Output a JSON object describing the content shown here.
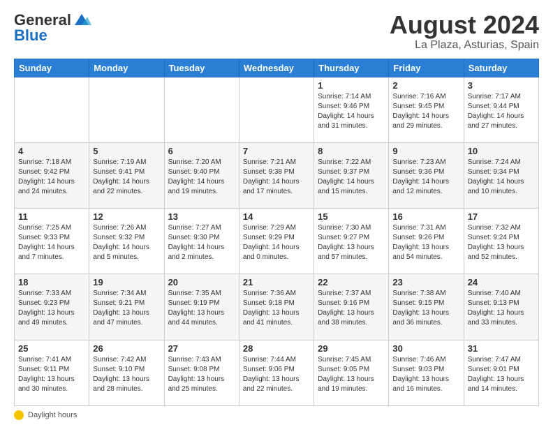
{
  "header": {
    "logo_line1": "General",
    "logo_line2": "Blue",
    "main_title": "August 2024",
    "subtitle": "La Plaza, Asturias, Spain"
  },
  "calendar": {
    "days_of_week": [
      "Sunday",
      "Monday",
      "Tuesday",
      "Wednesday",
      "Thursday",
      "Friday",
      "Saturday"
    ],
    "weeks": [
      [
        {
          "day": "",
          "info": ""
        },
        {
          "day": "",
          "info": ""
        },
        {
          "day": "",
          "info": ""
        },
        {
          "day": "",
          "info": ""
        },
        {
          "day": "1",
          "info": "Sunrise: 7:14 AM\nSunset: 9:46 PM\nDaylight: 14 hours\nand 31 minutes."
        },
        {
          "day": "2",
          "info": "Sunrise: 7:16 AM\nSunset: 9:45 PM\nDaylight: 14 hours\nand 29 minutes."
        },
        {
          "day": "3",
          "info": "Sunrise: 7:17 AM\nSunset: 9:44 PM\nDaylight: 14 hours\nand 27 minutes."
        }
      ],
      [
        {
          "day": "4",
          "info": "Sunrise: 7:18 AM\nSunset: 9:42 PM\nDaylight: 14 hours\nand 24 minutes."
        },
        {
          "day": "5",
          "info": "Sunrise: 7:19 AM\nSunset: 9:41 PM\nDaylight: 14 hours\nand 22 minutes."
        },
        {
          "day": "6",
          "info": "Sunrise: 7:20 AM\nSunset: 9:40 PM\nDaylight: 14 hours\nand 19 minutes."
        },
        {
          "day": "7",
          "info": "Sunrise: 7:21 AM\nSunset: 9:38 PM\nDaylight: 14 hours\nand 17 minutes."
        },
        {
          "day": "8",
          "info": "Sunrise: 7:22 AM\nSunset: 9:37 PM\nDaylight: 14 hours\nand 15 minutes."
        },
        {
          "day": "9",
          "info": "Sunrise: 7:23 AM\nSunset: 9:36 PM\nDaylight: 14 hours\nand 12 minutes."
        },
        {
          "day": "10",
          "info": "Sunrise: 7:24 AM\nSunset: 9:34 PM\nDaylight: 14 hours\nand 10 minutes."
        }
      ],
      [
        {
          "day": "11",
          "info": "Sunrise: 7:25 AM\nSunset: 9:33 PM\nDaylight: 14 hours\nand 7 minutes."
        },
        {
          "day": "12",
          "info": "Sunrise: 7:26 AM\nSunset: 9:32 PM\nDaylight: 14 hours\nand 5 minutes."
        },
        {
          "day": "13",
          "info": "Sunrise: 7:27 AM\nSunset: 9:30 PM\nDaylight: 14 hours\nand 2 minutes."
        },
        {
          "day": "14",
          "info": "Sunrise: 7:29 AM\nSunset: 9:29 PM\nDaylight: 14 hours\nand 0 minutes."
        },
        {
          "day": "15",
          "info": "Sunrise: 7:30 AM\nSunset: 9:27 PM\nDaylight: 13 hours\nand 57 minutes."
        },
        {
          "day": "16",
          "info": "Sunrise: 7:31 AM\nSunset: 9:26 PM\nDaylight: 13 hours\nand 54 minutes."
        },
        {
          "day": "17",
          "info": "Sunrise: 7:32 AM\nSunset: 9:24 PM\nDaylight: 13 hours\nand 52 minutes."
        }
      ],
      [
        {
          "day": "18",
          "info": "Sunrise: 7:33 AM\nSunset: 9:23 PM\nDaylight: 13 hours\nand 49 minutes."
        },
        {
          "day": "19",
          "info": "Sunrise: 7:34 AM\nSunset: 9:21 PM\nDaylight: 13 hours\nand 47 minutes."
        },
        {
          "day": "20",
          "info": "Sunrise: 7:35 AM\nSunset: 9:19 PM\nDaylight: 13 hours\nand 44 minutes."
        },
        {
          "day": "21",
          "info": "Sunrise: 7:36 AM\nSunset: 9:18 PM\nDaylight: 13 hours\nand 41 minutes."
        },
        {
          "day": "22",
          "info": "Sunrise: 7:37 AM\nSunset: 9:16 PM\nDaylight: 13 hours\nand 38 minutes."
        },
        {
          "day": "23",
          "info": "Sunrise: 7:38 AM\nSunset: 9:15 PM\nDaylight: 13 hours\nand 36 minutes."
        },
        {
          "day": "24",
          "info": "Sunrise: 7:40 AM\nSunset: 9:13 PM\nDaylight: 13 hours\nand 33 minutes."
        }
      ],
      [
        {
          "day": "25",
          "info": "Sunrise: 7:41 AM\nSunset: 9:11 PM\nDaylight: 13 hours\nand 30 minutes."
        },
        {
          "day": "26",
          "info": "Sunrise: 7:42 AM\nSunset: 9:10 PM\nDaylight: 13 hours\nand 28 minutes."
        },
        {
          "day": "27",
          "info": "Sunrise: 7:43 AM\nSunset: 9:08 PM\nDaylight: 13 hours\nand 25 minutes."
        },
        {
          "day": "28",
          "info": "Sunrise: 7:44 AM\nSunset: 9:06 PM\nDaylight: 13 hours\nand 22 minutes."
        },
        {
          "day": "29",
          "info": "Sunrise: 7:45 AM\nSunset: 9:05 PM\nDaylight: 13 hours\nand 19 minutes."
        },
        {
          "day": "30",
          "info": "Sunrise: 7:46 AM\nSunset: 9:03 PM\nDaylight: 13 hours\nand 16 minutes."
        },
        {
          "day": "31",
          "info": "Sunrise: 7:47 AM\nSunset: 9:01 PM\nDaylight: 13 hours\nand 14 minutes."
        }
      ]
    ]
  },
  "footer": {
    "daylight_label": "Daylight hours"
  }
}
